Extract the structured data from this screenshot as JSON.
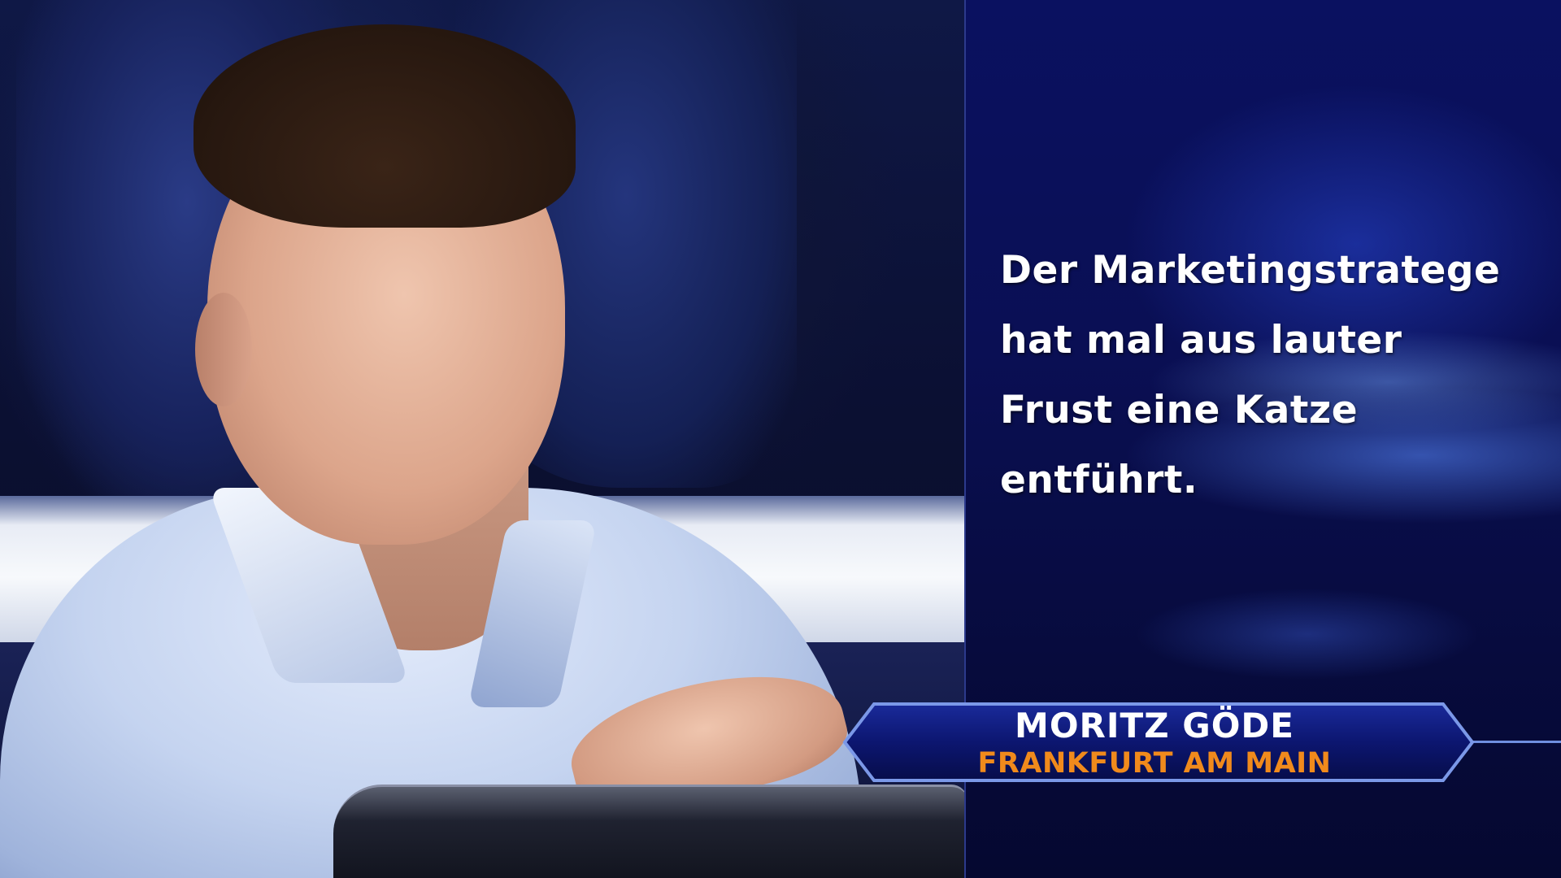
{
  "question": {
    "lines": [
      "Der Marketingstratege",
      "hat mal aus lauter",
      "Frust eine Katze",
      "entführt."
    ]
  },
  "contestant": {
    "name": "MORITZ GÖDE",
    "city": "FRANKFURT AM MAIN"
  },
  "colors": {
    "panel_blue": "#0a1160",
    "name_text": "#ffffff",
    "city_text": "#f08a1c",
    "banner_border": "#6f8fe0"
  }
}
